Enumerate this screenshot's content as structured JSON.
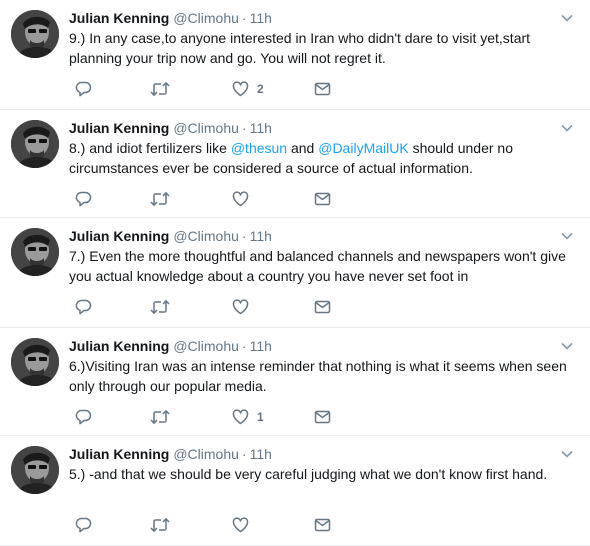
{
  "author": {
    "name": "Julian Kenning",
    "handle": "@Climohu",
    "separator": "·"
  },
  "tweets": [
    {
      "time": "11h",
      "parts": [
        {
          "text": "9.) In any case,to anyone interested in Iran who didn't dare to visit yet,start planning your trip now and go. You will not regret it.",
          "mention": false
        }
      ],
      "replies": "",
      "retweets": "",
      "likes": "2"
    },
    {
      "time": "11h",
      "parts": [
        {
          "text": "8.) and idiot fertilizers like ",
          "mention": false
        },
        {
          "text": "@thesun",
          "mention": true
        },
        {
          "text": " and ",
          "mention": false
        },
        {
          "text": "@DailyMailUK",
          "mention": true
        },
        {
          "text": " should under no circumstances ever be considered a source of actual information.",
          "mention": false
        }
      ],
      "replies": "",
      "retweets": "",
      "likes": ""
    },
    {
      "time": "11h",
      "parts": [
        {
          "text": "7.) Even the more thoughtful and balanced channels and newspapers won't give you actual knowledge about a country you have never set foot in",
          "mention": false
        }
      ],
      "replies": "",
      "retweets": "",
      "likes": ""
    },
    {
      "time": "11h",
      "parts": [
        {
          "text": "6.)Visiting Iran was an intense reminder that nothing is what it seems when seen only through our popular media.",
          "mention": false
        }
      ],
      "replies": "",
      "retweets": "",
      "likes": "1"
    },
    {
      "time": "11h",
      "parts": [
        {
          "text": "5.) -and that we should be very careful judging what we don't know first hand.",
          "mention": false
        }
      ],
      "replies": "",
      "retweets": "",
      "likes": ""
    }
  ],
  "icons": {
    "reply": "reply-icon",
    "retweet": "retweet-icon",
    "like": "heart-icon",
    "dm": "envelope-icon",
    "more": "chevron-down-icon"
  },
  "colors": {
    "text": "#14171a",
    "secondary": "#657786",
    "link": "#1da1f2",
    "divider": "#e6ecf0"
  }
}
